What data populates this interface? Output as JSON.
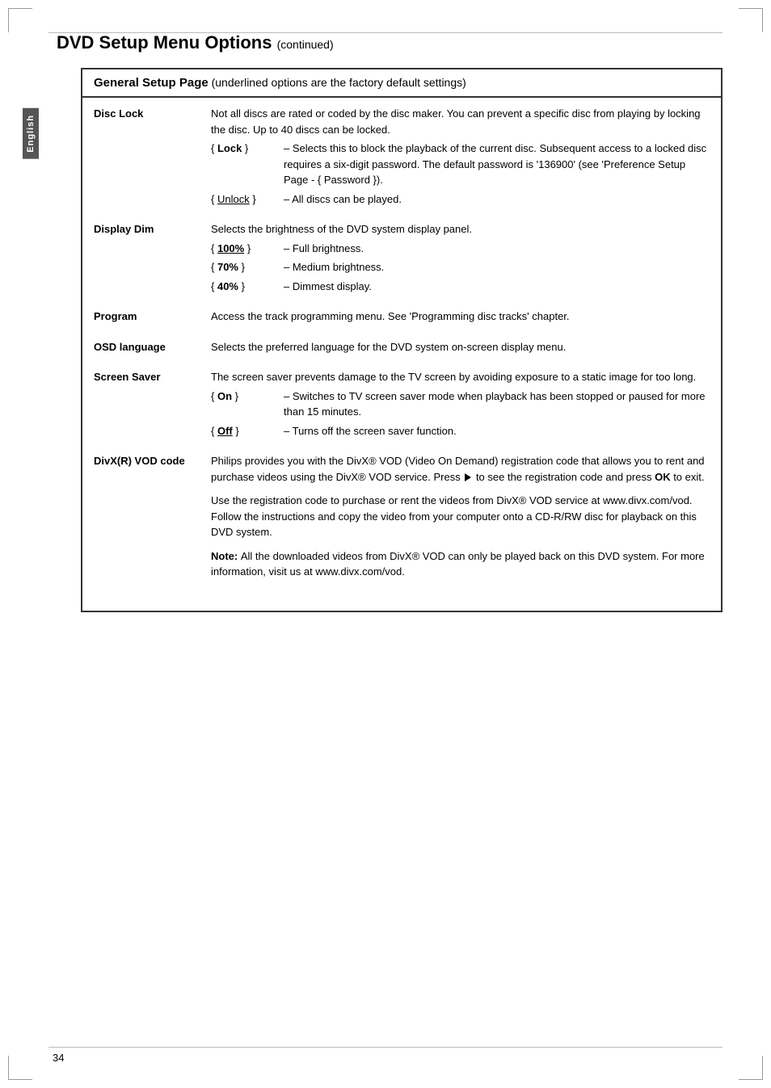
{
  "page": {
    "title": "DVD Setup Menu Options",
    "title_continued": "(continued)",
    "page_number": "34"
  },
  "sidebar": {
    "language_label": "English"
  },
  "section": {
    "header_bold": "General Setup Page",
    "header_note": "(underlined options are the factory default settings)"
  },
  "settings": [
    {
      "id": "disc-lock",
      "label": "Disc Lock",
      "description": "Not all discs are rated or coded by the disc maker.  You can prevent a specific disc from playing by locking the disc.  Up to 40 discs can be locked.",
      "options": [
        {
          "key": "{ Lock }",
          "key_underlined": false,
          "value": "– Selects this to block the playback of the current disc.  Subsequent access to a locked disc requires a six-digit password.  The default password is '136900' (see 'Preference Setup Page - { Password })."
        },
        {
          "key": "{ Unlock }",
          "key_underlined": true,
          "value": "– All discs can be played."
        }
      ]
    },
    {
      "id": "display-dim",
      "label": "Display Dim",
      "description": "Selects the brightness of the DVD system display panel.",
      "options": [
        {
          "key": "{ 100% }",
          "key_underlined": true,
          "value": "– Full brightness."
        },
        {
          "key": "{ 70% }",
          "key_underlined": false,
          "value": "– Medium brightness."
        },
        {
          "key": "{ 40% }",
          "key_underlined": false,
          "value": "– Dimmest display."
        }
      ]
    },
    {
      "id": "program",
      "label": "Program",
      "description": "Access the track programming menu.  See 'Programming disc tracks' chapter.",
      "options": []
    },
    {
      "id": "osd-language",
      "label": "OSD language",
      "description": "Selects the preferred language for the DVD system on-screen display menu.",
      "options": []
    },
    {
      "id": "screen-saver",
      "label": "Screen Saver",
      "description": "The screen saver prevents damage to the TV screen by avoiding exposure to a static image for too long.",
      "options": [
        {
          "key": "{ On }",
          "key_underlined": false,
          "value": "– Switches to TV screen saver mode when playback has been stopped or paused for more than 15 minutes."
        },
        {
          "key": "{ Off }",
          "key_underlined": true,
          "value": "– Turns off the screen saver function."
        }
      ]
    },
    {
      "id": "divx-vod",
      "label": "DivX(R) VOD code",
      "description_parts": [
        {
          "type": "paragraph",
          "text": "Philips provides you with the DivX® VOD (Video On Demand) registration code that allows you to rent and purchase videos using the DivX® VOD service.  Press ▶ to see the registration code and press OK to exit."
        },
        {
          "type": "paragraph",
          "text": "Use the registration code to purchase or rent the videos from DivX® VOD service at www.divx.com/vod.  Follow the instructions and copy the video from your computer onto a CD-R/RW disc for playback on this DVD system."
        },
        {
          "type": "note",
          "label": "Note: ",
          "text": "All the downloaded videos from DivX® VOD can only be played back on this DVD system.  For more information, visit us at www.divx.com/vod."
        }
      ],
      "options": []
    }
  ]
}
